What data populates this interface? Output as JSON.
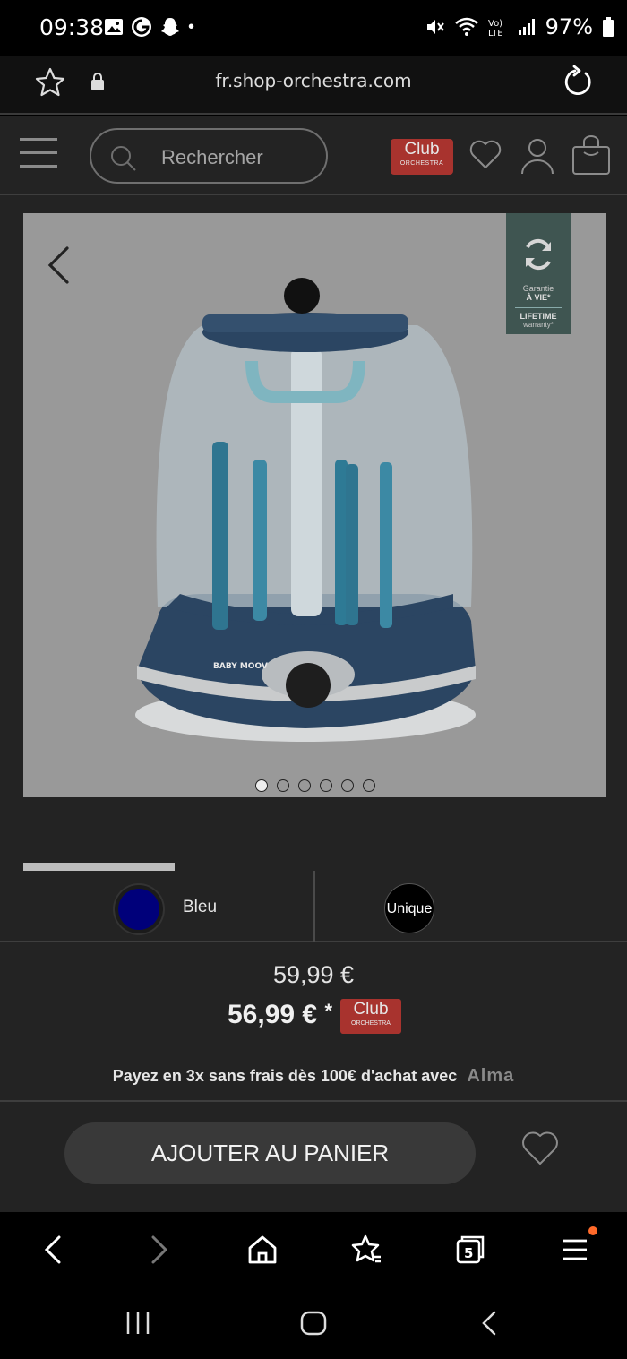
{
  "status_bar": {
    "time": "09:38",
    "battery": "97%",
    "dot": "•",
    "icons": [
      "gallery-icon",
      "music-icon",
      "snapchat-icon",
      "mute-icon",
      "wifi-icon",
      "volte-icon",
      "signal-icon",
      "battery-icon"
    ]
  },
  "browser": {
    "url": "fr.shop-orchestra.com"
  },
  "header": {
    "search_placeholder": "Rechercher",
    "club_label": "Club",
    "club_sub": "ORCHESTRA"
  },
  "product": {
    "guarantee_top": "Garantie",
    "guarantee_mid": "À VIE*",
    "guarantee_bottom": "LIFETIME",
    "guarantee_sub": "warranty*",
    "image_count": 6,
    "active_image": 1,
    "brand_on_image": "BABY MOOV",
    "gallery_progress": 0.26
  },
  "variants": {
    "color_label": "Bleu",
    "color_hex": "#00007a",
    "size_label": "Unique"
  },
  "price": {
    "old": "59,99 €",
    "new": "56,99 €",
    "asterisk": "*",
    "club_label": "Club",
    "club_sub": "ORCHESTRA"
  },
  "payment": {
    "text": "Payez en 3x sans frais dès 100€ d'achat avec",
    "brand": "Alma"
  },
  "cta": {
    "add_to_cart": "AJOUTER AU PANIER"
  },
  "colors": {
    "background": "#232323",
    "club_red": "#a8332e",
    "guarantee_green": "#3f5551",
    "notification": "#ff6a2a"
  }
}
